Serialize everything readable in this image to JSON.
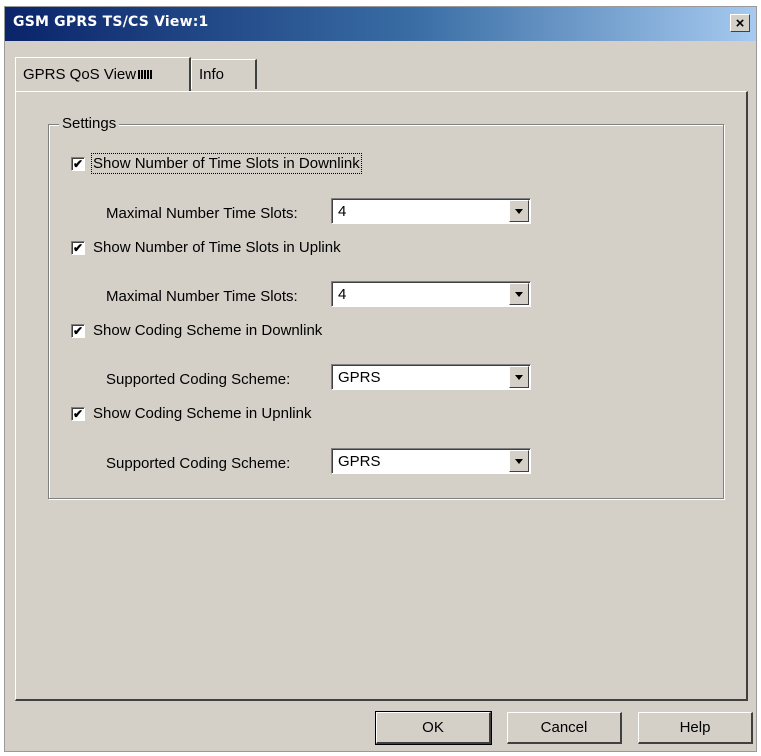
{
  "window": {
    "title": "GSM GPRS TS/CS View:1",
    "close_glyph": "×"
  },
  "tabs": [
    {
      "label": "GPRS QoS View",
      "active": true
    },
    {
      "label": "Info",
      "active": false
    }
  ],
  "settings": {
    "legend": "Settings",
    "options": [
      {
        "check_label": "Show Number of Time Slots in Downlink",
        "checked": true,
        "field_label": "Maximal Number Time Slots:",
        "value": "4"
      },
      {
        "check_label": "Show Number of Time Slots in Uplink",
        "checked": true,
        "field_label": "Maximal Number Time Slots:",
        "value": "4"
      },
      {
        "check_label": "Show Coding Scheme in Downlink",
        "checked": true,
        "field_label": "Supported Coding Scheme:",
        "value": "GPRS"
      },
      {
        "check_label": "Show Coding Scheme in Upnlink",
        "checked": true,
        "field_label": "Supported Coding Scheme:",
        "value": "GPRS"
      }
    ]
  },
  "buttons": {
    "ok": "OK",
    "cancel": "Cancel",
    "help": "Help"
  },
  "check_glyph": "✔"
}
